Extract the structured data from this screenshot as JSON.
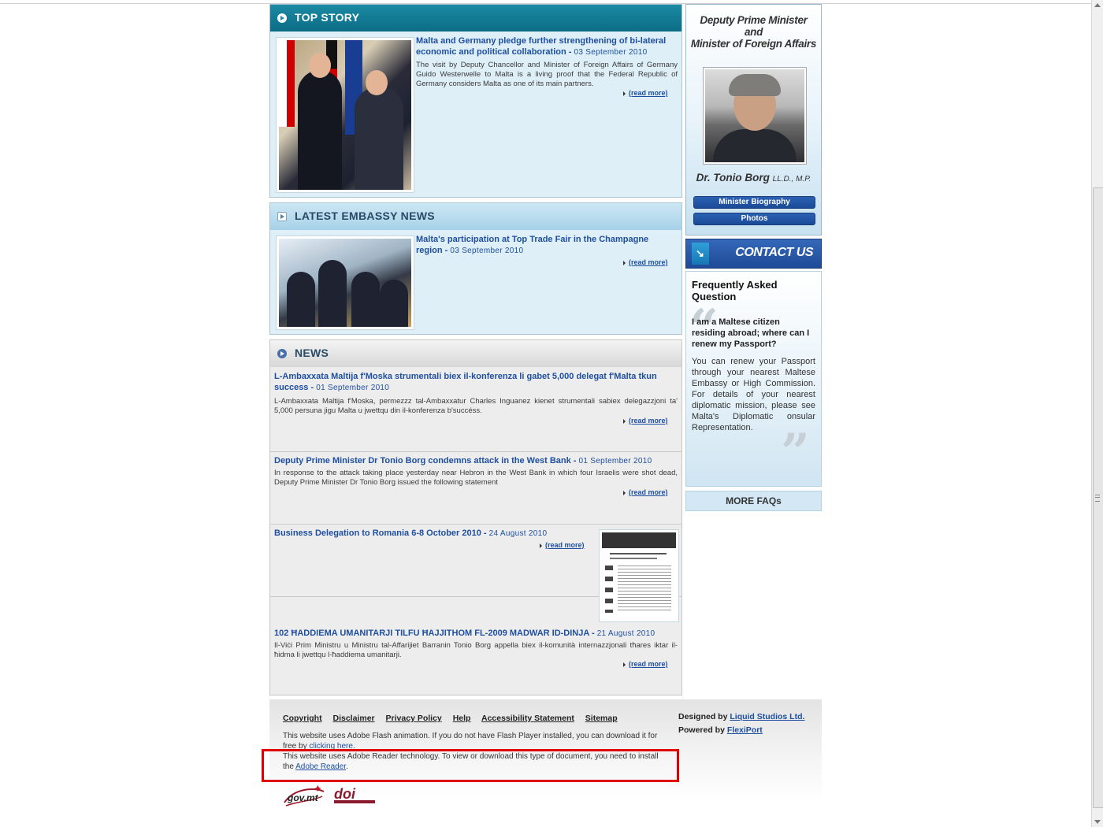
{
  "top_story": {
    "heading": "TOP STORY",
    "title": "Malta and Germany pledge further strengthening of bi-lateral economic and political collaboration",
    "date": "03 September 2010",
    "text": "The visit by Deputy Chancellor and Minister of Foreign Affairs of Germany Guido Westerwelle to Malta is a living proof that the Federal Republic of Germany considers Malta as one of its main partners.",
    "read_more": "(read more)"
  },
  "embassy_news": {
    "heading": "LATEST EMBASSY NEWS",
    "title": "Malta's participation at Top Trade Fair in the Champagne region",
    "date": "03 September 2010",
    "read_more": "(read more)"
  },
  "news": {
    "heading": "NEWS",
    "items": [
      {
        "title": "L-Ambaxxata Maltija f'Moska strumentali biex il-konferenza li gabet 5,000 delegat f'Malta tkun success",
        "date": "01 September 2010",
        "text": "L-Ambaxxata Maltija f'Moska, permezzz tal-Ambaxxatur Charles Inguanez kienet strumentali sabiex delegazzjoni ta' 5,000 persuna jigu Malta u jwettqu din il-konferenza b'succéss.",
        "read_more": "(read more)"
      },
      {
        "title": "Deputy Prime Minister Dr Tonio Borg condemns attack in the West Bank",
        "date": "01 September 2010",
        "text": "In response to the attack taking place yesterday near Hebron in the West Bank in which four Israelis were shot dead, Deputy Prime Minister Dr Tonio Borg issued the following statement",
        "read_more": "(read more)"
      },
      {
        "title": "Business Delegation to Romania 6-8 October 2010",
        "date": "24 August 2010",
        "text": "",
        "read_more": "(read more)"
      },
      {
        "title": "102 ĦADDIEMA UMANITARJI TILFU ĦAJJITHOM FL-2009 MADWAR ID-DINJA",
        "date": "21 August 2010",
        "text": "Il-Viċi Prim Ministru u Ministru tal-Affarijiet Barranin Tonio Borg appella biex il-komunità internazzjonali tħares iktar il-ħidma li jwettqu l-ħaddiema umanitarji.",
        "read_more": "(read more)"
      }
    ]
  },
  "minister": {
    "title_line1": "Deputy Prime Minister",
    "title_line2": "and",
    "title_line3": "Minister of Foreign Affairs",
    "name": "Dr. Tonio Borg",
    "name_suffix": "LL.D., M.P.",
    "biography_button": "Minister Biography",
    "photos_button": "Photos"
  },
  "contact": {
    "label": "CONTACT US"
  },
  "faq": {
    "heading": "Frequently Asked Question",
    "question": "I am a Maltese citizen residing abroad; where can I renew my Passport?",
    "answer": "You can renew your Passport through your nearest Maltese Embassy or High Commission. For details of your nearest diplomatic mission, please see Malta's Diplomatic onsular Representation.",
    "more_label": "MORE FAQs"
  },
  "footer": {
    "links": [
      "Copyright",
      "Disclaimer",
      "Privacy Policy",
      "Help",
      "Accessibility Statement",
      "Sitemap"
    ],
    "flash_note": "This website uses Adobe Flash animation. If you do not have Flash Player installed, you can download it for free by",
    "flash_link": "clicking here",
    "reader_note": "This website uses Adobe Reader technology. To view or download this type of document, you need to install the",
    "reader_link": "Adobe Reader",
    "designed_by_label": "Designed by",
    "designed_by": "Liquid Studios Ltd.",
    "powered_by_label": "Powered by",
    "powered_by": "FlexiPort",
    "logo_govmt": "gov.mt",
    "logo_doi": "doi"
  },
  "colors": {
    "highlight": "#e00000",
    "link": "#1e4fa0",
    "top_story_header": "#0c6c85"
  }
}
